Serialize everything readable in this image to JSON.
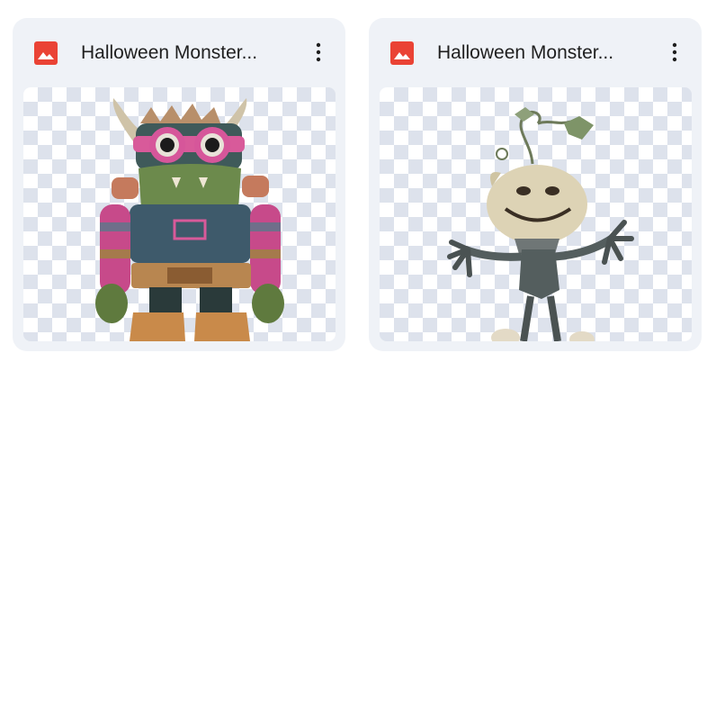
{
  "files": [
    {
      "title": "Halloween Monster...",
      "icon": "image-file-icon",
      "icon_color": "#ea4335",
      "menu_icon": "more-vert-icon",
      "thumbnail": "pink goggled knitted horned monster"
    },
    {
      "title": "Halloween Monster...",
      "icon": "image-file-icon",
      "icon_color": "#ea4335",
      "menu_icon": "more-vert-icon",
      "thumbnail": "burlap pumpkin-head scarecrow creature"
    }
  ],
  "colors": {
    "card_bg": "#eff2f7",
    "title_text": "#1f1f1f",
    "checker": "#dde2ec"
  }
}
